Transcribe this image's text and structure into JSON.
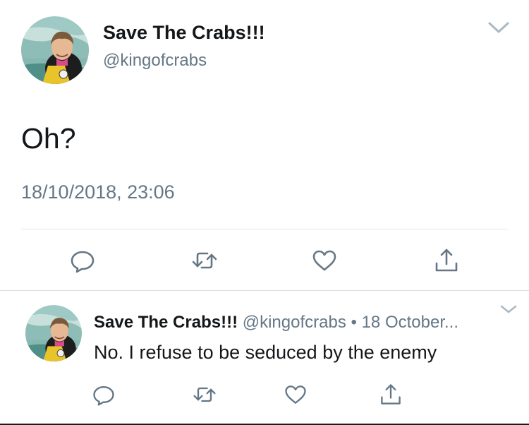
{
  "main_tweet": {
    "display_name": "Save The Crabs!!!",
    "handle": "@kingofcrabs",
    "text": "Oh?",
    "timestamp": "18/10/2018, 23:06",
    "avatar_icon": "profile-photo",
    "caret_icon": "chevron-down-icon",
    "actions": [
      "reply-icon",
      "retweet-icon",
      "like-icon",
      "share-icon"
    ]
  },
  "reply_tweet": {
    "display_name": "Save The Crabs!!!",
    "handle": "@kingofcrabs",
    "separator": "•",
    "date": "18 October...",
    "text": "No. I refuse to be seduced by the enemy",
    "avatar_icon": "profile-photo",
    "caret_icon": "chevron-down-icon",
    "actions": [
      "reply-icon",
      "retweet-icon",
      "like-icon",
      "share-icon"
    ]
  },
  "colors": {
    "text_primary": "#14171a",
    "text_secondary": "#657786",
    "icon_gray": "#657786",
    "divider": "#e1e8ed"
  }
}
